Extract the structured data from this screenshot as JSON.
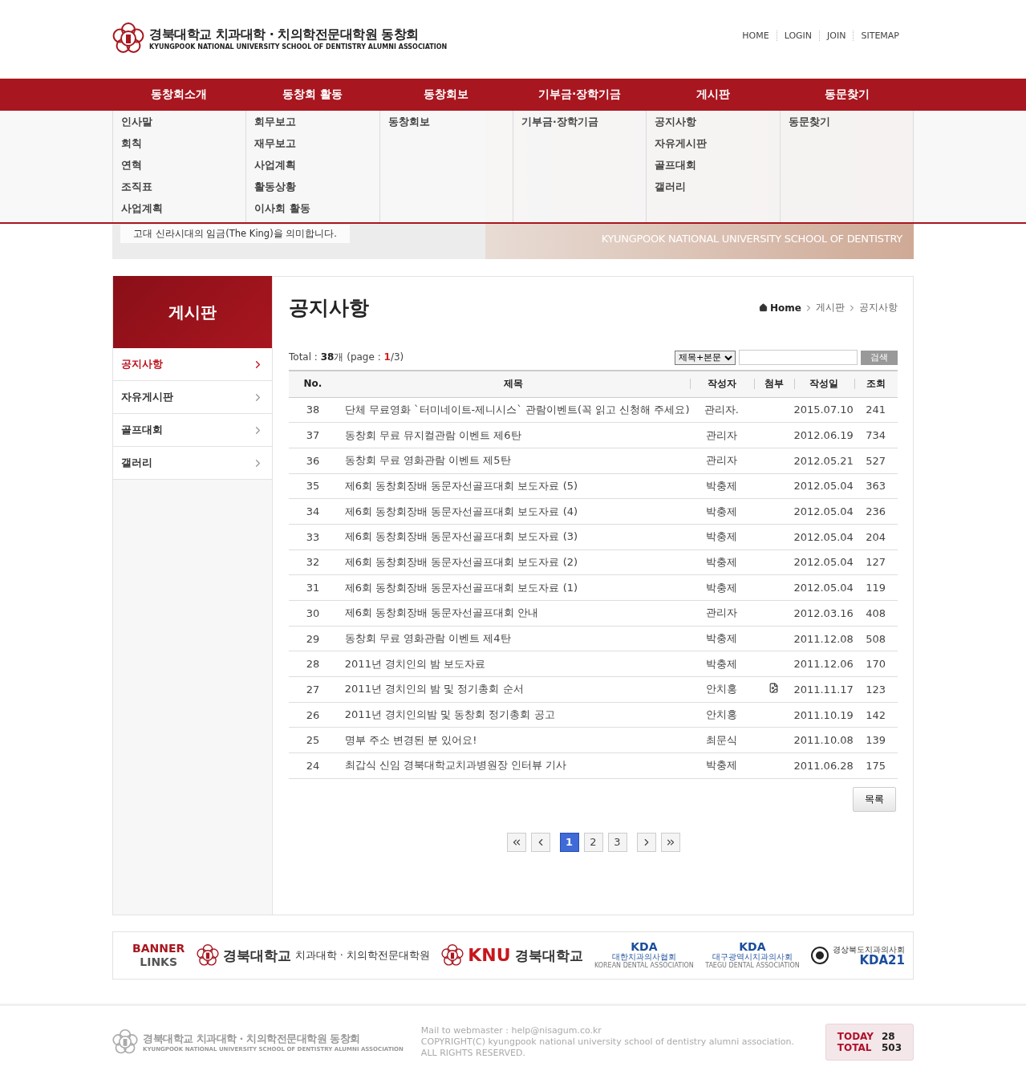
{
  "header": {
    "logo_title": "경북대학교 치과대학 · 치의학전문대학원 동창회",
    "logo_subtitle": "KYUNGPOOK NATIONAL UNIVERSITY SCHOOL OF DENTISTRY ALUMNI ASSOCIATION",
    "top_links": [
      "HOME",
      "LOGIN",
      "JOIN",
      "SITEMAP"
    ]
  },
  "nav": [
    {
      "label": "동창회소개",
      "items": [
        "인사말",
        "회칙",
        "연혁",
        "조직표",
        "사업계획"
      ]
    },
    {
      "label": "동창회 활동",
      "items": [
        "회무보고",
        "재무보고",
        "사업계획",
        "활동상황",
        "이사회 활동"
      ]
    },
    {
      "label": "동창회보",
      "items": [
        "동창회보"
      ]
    },
    {
      "label": "기부금·장학기금",
      "items": [
        "기부금·장학기금"
      ]
    },
    {
      "label": "게시판",
      "items": [
        "공지사항",
        "자유게시판",
        "골프대회",
        "갤러리"
      ]
    },
    {
      "label": "동문찾기",
      "items": [
        "동문찾기"
      ]
    }
  ],
  "hero": {
    "caption": "고대 신라시대의 임금(The King)을 의미합니다.",
    "subtitle": "KYUNGPOOK NATIONAL UNIVERSITY SCHOOL OF DENTISTRY"
  },
  "sidebar": {
    "title": "게시판",
    "items": [
      {
        "label": "공지사항",
        "selected": true
      },
      {
        "label": "자유게시판",
        "selected": false
      },
      {
        "label": "골프대회",
        "selected": false
      },
      {
        "label": "갤러리",
        "selected": false
      }
    ]
  },
  "content": {
    "title": "공지사항",
    "breadcrumb": [
      "Home",
      "게시판",
      "공지사항"
    ],
    "summary": "Total : **38**개 (page : **1**/3)",
    "search": {
      "select": "제목+본문",
      "button": "검색"
    },
    "columns": [
      "No.",
      "제목",
      "작성자",
      "첨부",
      "작성일",
      "조회"
    ],
    "rows": [
      {
        "no": "38",
        "title": "단체 무료영화 `터미네이트-제니시스` 관람이벤트(꼭 읽고 신청해 주세요)",
        "author": "관리자.",
        "attachment": false,
        "date": "2015.07.10",
        "views": "241"
      },
      {
        "no": "37",
        "title": "동창회 무료 뮤지컬관람 이벤트 제6탄",
        "author": "관리자",
        "attachment": false,
        "date": "2012.06.19",
        "views": "734"
      },
      {
        "no": "36",
        "title": "동창회 무료 영화관람 이벤트 제5탄",
        "author": "관리자",
        "attachment": false,
        "date": "2012.05.21",
        "views": "527"
      },
      {
        "no": "35",
        "title": "제6회 동창회장배 동문자선골프대회 보도자료 (5)",
        "author": "박충제",
        "attachment": false,
        "date": "2012.05.04",
        "views": "363"
      },
      {
        "no": "34",
        "title": "제6회 동창회장배 동문자선골프대회 보도자료 (4)",
        "author": "박충제",
        "attachment": false,
        "date": "2012.05.04",
        "views": "236"
      },
      {
        "no": "33",
        "title": "제6회 동창회장배 동문자선골프대회 보도자료 (3)",
        "author": "박충제",
        "attachment": false,
        "date": "2012.05.04",
        "views": "204"
      },
      {
        "no": "32",
        "title": "제6회 동창회장배 동문자선골프대회 보도자료 (2)",
        "author": "박충제",
        "attachment": false,
        "date": "2012.05.04",
        "views": "127"
      },
      {
        "no": "31",
        "title": "제6회 동창회장배 동문자선골프대회 보도자료 (1)",
        "author": "박충제",
        "attachment": false,
        "date": "2012.05.04",
        "views": "119"
      },
      {
        "no": "30",
        "title": "제6회 동창회장배 동문자선골프대회 안내",
        "author": "관리자",
        "attachment": false,
        "date": "2012.03.16",
        "views": "408"
      },
      {
        "no": "29",
        "title": "동창회 무료 영화관람 이벤트 제4탄",
        "author": "박충제",
        "attachment": false,
        "date": "2011.12.08",
        "views": "508"
      },
      {
        "no": "28",
        "title": "2011년 경치인의 밤 보도자료",
        "author": "박충제",
        "attachment": false,
        "date": "2011.12.06",
        "views": "170"
      },
      {
        "no": "27",
        "title": "2011년 경치인의 밤 및 정기총회 순서",
        "author": "안치홍",
        "attachment": true,
        "date": "2011.11.17",
        "views": "123"
      },
      {
        "no": "26",
        "title": "2011년 경치인의밤 및 동창회 정기총회 공고",
        "author": "안치홍",
        "attachment": false,
        "date": "2011.10.19",
        "views": "142"
      },
      {
        "no": "25",
        "title": "명부 주소 변경된 분 있어요!",
        "author": "최문식",
        "attachment": false,
        "date": "2011.10.08",
        "views": "139"
      },
      {
        "no": "24",
        "title": "최갑식 신임 경북대학교치과병원장 인터뷰 기사",
        "author": "박충제",
        "attachment": false,
        "date": "2011.06.28",
        "views": "175"
      }
    ],
    "list_button": "목록",
    "pagination": [
      {
        "kind": "first",
        "selected": false
      },
      {
        "kind": "prev",
        "selected": false
      },
      {
        "kind": "page",
        "label": "1",
        "selected": true
      },
      {
        "kind": "page",
        "label": "2",
        "selected": false
      },
      {
        "kind": "page",
        "label": "3",
        "selected": false
      },
      {
        "kind": "next",
        "selected": false
      },
      {
        "kind": "last",
        "selected": false
      }
    ]
  },
  "banner": {
    "title": [
      "BANNER",
      "LINKS"
    ],
    "links": [
      {
        "kind": "school",
        "name": "경북대학교",
        "sub": "치과대학 · 치의학전문대학원"
      },
      {
        "kind": "knu",
        "name": "KNU",
        "sub": "경북대학교"
      },
      {
        "kind": "kda",
        "name": "KDA",
        "sub": "대한치과의사협회",
        "en": "KOREAN DENTAL ASSOCIATION"
      },
      {
        "kind": "kda",
        "name": "KDA",
        "sub": "대구광역시치과의사회",
        "en": "TAEGU DENTAL ASSOCIATION"
      },
      {
        "kind": "kda21",
        "name": "KDA21",
        "sub": "경상북도치과의사회"
      }
    ]
  },
  "footer": {
    "logo_title": "경북대학교 치과대학 · 치의학전문대학원 동창회",
    "logo_subtitle": "KYUNGPOOK NATIONAL UNIVERSITY SCHOOL OF DENTISTRY ALUMNI ASSOCIATION",
    "lines": [
      "Mail to webmaster : help@nisagum.co.kr",
      "COPYRIGHT(C) kyungpook national university school of dentistry alumni association.",
      "ALL RIGHTS RESERVED."
    ],
    "counters": [
      {
        "label": "TODAY",
        "value": "28"
      },
      {
        "label": "TOTAL",
        "value": "503"
      }
    ]
  }
}
